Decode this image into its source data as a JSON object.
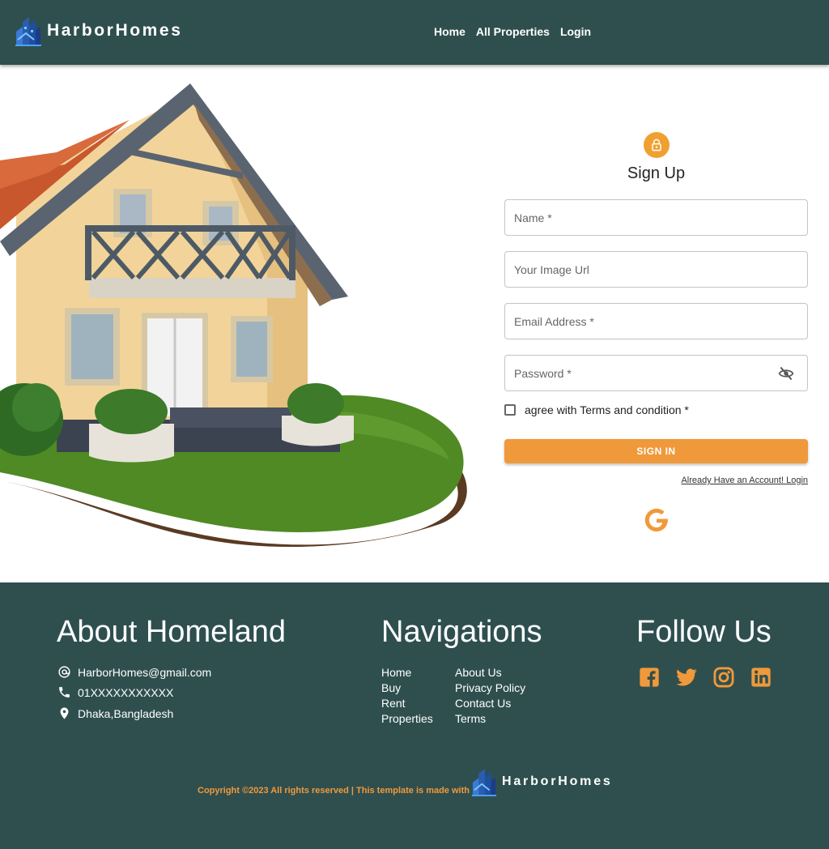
{
  "header": {
    "brand": "HarborHomes",
    "nav": [
      "Home",
      "All Properties",
      "Login"
    ]
  },
  "form": {
    "title": "Sign Up",
    "fields": {
      "name": "Name *",
      "image": "Your Image Url",
      "email": "Email Address *",
      "password": "Password *"
    },
    "agree_label": "agree with Terms and condition *",
    "signin_label": "SIGN IN",
    "login_link": "Already Have an Account! Login"
  },
  "footer": {
    "about_title": "About Homeland",
    "email": "HarborHomes@gmail.com",
    "phone": "01XXXXXXXXXXX",
    "address": "Dhaka,Bangladesh",
    "nav_title": "Navigations",
    "nav_col1": [
      "Home",
      "Buy",
      "Rent",
      "Properties"
    ],
    "nav_col2": [
      "About Us",
      "Privacy Policy",
      "Contact Us",
      "Terms"
    ],
    "follow_title": "Follow Us",
    "social_icons": [
      "facebook-icon",
      "twitter-icon",
      "instagram-icon",
      "linkedin-icon"
    ],
    "copyright": "Copyright ©2023 All rights reserved | This template is made with",
    "brand": "HarborHomes"
  },
  "colors": {
    "header_bg": "#2f4f4f",
    "accent": "#f0993a",
    "footer_bg": "#2f4f4f"
  }
}
